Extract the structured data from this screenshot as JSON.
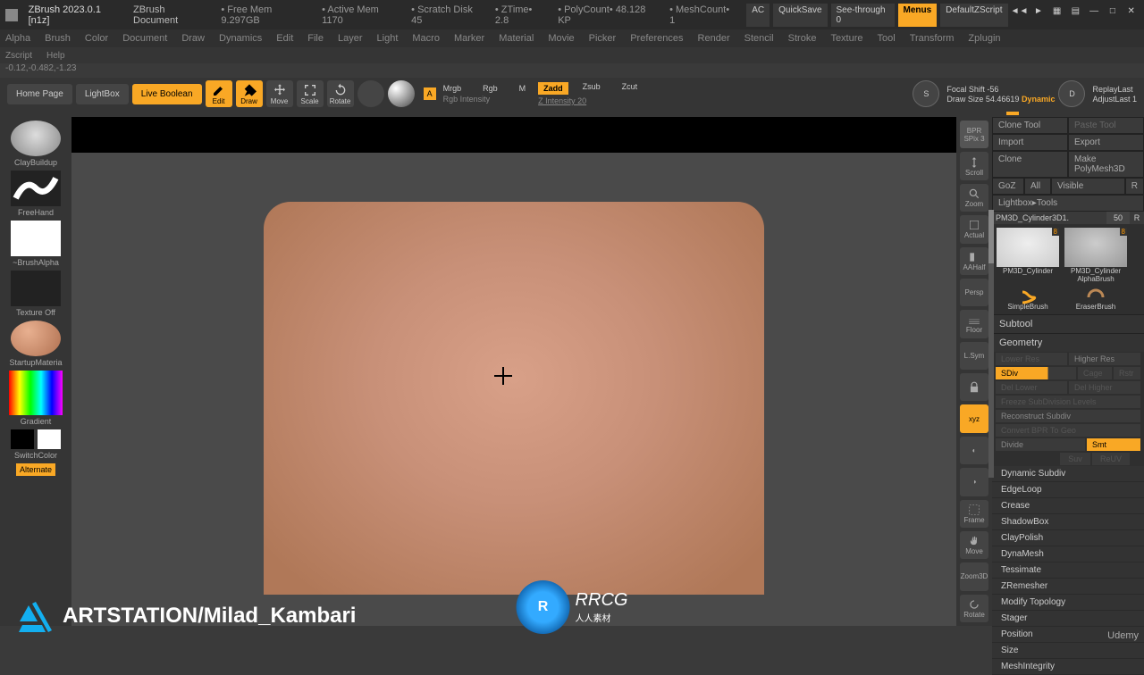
{
  "title_bar": {
    "app": "ZBrush 2023.0.1 [n1z]",
    "doc": "ZBrush Document",
    "stats": [
      "• Free Mem 9.297GB",
      "• Active Mem 1170",
      "• Scratch Disk 45",
      "• ZTime• 2.8",
      "• PolyCount• 48.128 KP",
      "• MeshCount• 1"
    ],
    "ac": "AC",
    "quicksave": "QuickSave",
    "see_through": "See-through  0",
    "menus": "Menus",
    "default_script": "DefaultZScript"
  },
  "menu_bar": [
    "Alpha",
    "Brush",
    "Color",
    "Document",
    "Draw",
    "Dynamics",
    "Edit",
    "File",
    "Layer",
    "Light",
    "Macro",
    "Marker",
    "Material",
    "Movie",
    "Picker",
    "Preferences",
    "Render",
    "Stencil",
    "Stroke",
    "Texture",
    "Tool",
    "Transform",
    "Zplugin"
  ],
  "script_bar": {
    "zscript": "Zscript",
    "help": "Help"
  },
  "status": "-0.12,-0.482,-1.23",
  "toolbar": {
    "home": "Home Page",
    "lightbox": "LightBox",
    "live_boolean": "Live Boolean",
    "edit": "Edit",
    "draw": "Draw",
    "move": "Move",
    "scale": "Scale",
    "rotate": "Rotate",
    "mrgb_a": "A",
    "mrgb": "Mrgb",
    "rgb": "Rgb",
    "m": "M",
    "rgb_intensity": "Rgb Intensity",
    "zadd": "Zadd",
    "zsub": "Zsub",
    "zcut": "Zcut",
    "z_intensity": "Z Intensity  20",
    "focal_shift": "Focal Shift -56",
    "draw_size": "Draw Size 54.46619",
    "dynamic": "Dynamic",
    "replay_last": "ReplayLast",
    "adjust_last": "AdjustLast 1"
  },
  "left_panel": {
    "brush": "ClayBuildup",
    "stroke": "FreeHand",
    "alpha": "~BrushAlpha",
    "texture": "Texture Off",
    "material": "StartupMateria",
    "gradient": "Gradient",
    "switch_color": "SwitchColor",
    "alternate": "Alternate"
  },
  "right_dock": {
    "bpr": "BPR",
    "spix": "SPix 3",
    "scroll": "Scroll",
    "zoom": "Zoom",
    "actual": "Actual",
    "aahalf": "AAHalf",
    "persp": "Persp",
    "floor": "Floor",
    "lsym": "L.Sym",
    "lock": "lock",
    "xyz": "xyz",
    "frame": "Frame",
    "move": "Move",
    "zoom3d": "Zoom3D",
    "rotate": "Rotate"
  },
  "right_panel": {
    "clone_tool": "Clone Tool",
    "paste_tool": "Paste Tool",
    "import": "Import",
    "export": "Export",
    "clone": "Clone",
    "make_polymesh": "Make PolyMesh3D",
    "goz": "GoZ",
    "all": "All",
    "visible": "Visible",
    "r1": "R",
    "lightbox_tools": "Lightbox▸Tools",
    "tool_name": "PM3D_Cylinder3D1.",
    "tool_num": "50",
    "r2": "R",
    "thumb1": {
      "label": "PM3D_Cylinder",
      "badge": "8"
    },
    "thumb2": {
      "label": "PM3D_Cylinder",
      "badge": "8"
    },
    "simple_brush": "SimpleBrush",
    "alpha_brush": "AlphaBrush",
    "eraser_brush": "EraserBrush",
    "subtool": "Subtool",
    "geometry": "Geometry",
    "lower_res": "Lower Res",
    "higher_res": "Higher Res",
    "sdiv": "SDiv",
    "cage": "Cage",
    "rstr": "Rstr",
    "del_lower": "Del Lower",
    "del_higher": "Del Higher",
    "freeze_sub": "Freeze SubDivision Levels",
    "reconstruct": "Reconstruct Subdiv",
    "convert_bpr": "Convert BPR To Geo",
    "divide": "Divide",
    "smt": "Smt",
    "suv": "Suv",
    "reuv": "ReUV",
    "list": [
      "Dynamic Subdiv",
      "EdgeLoop",
      "Crease",
      "ShadowBox",
      "ClayPolish",
      "DynaMesh",
      "Tessimate",
      "ZRemesher",
      "Modify Topology",
      "Stager",
      "Position",
      "Size",
      "MeshIntegrity"
    ]
  },
  "watermark": {
    "artstation": "ARTSTATION/Milad_Kambari",
    "center_logo": "R",
    "center_text": "RRCG",
    "center_sub": "人人素材",
    "udemy": "Udemy"
  }
}
